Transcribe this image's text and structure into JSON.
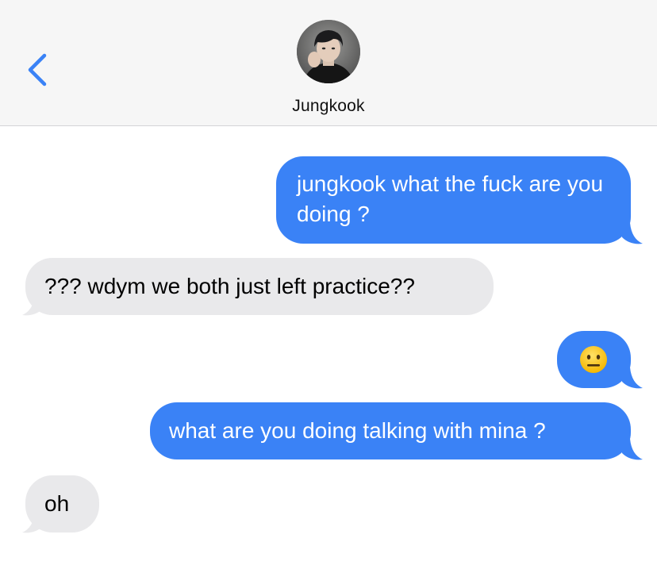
{
  "header": {
    "contact_name": "Jungkook",
    "avatar_icon": "contact-avatar-photo",
    "back_icon": "chevron-left-icon",
    "accent": "#3a82f6"
  },
  "messages": [
    {
      "direction": "sent",
      "text": "jungkook what the fuck are you doing ?"
    },
    {
      "direction": "received",
      "text": "??? wdym we both just left practice??"
    },
    {
      "direction": "sent",
      "emoji": "neutral-face-icon"
    },
    {
      "direction": "sent",
      "text": "what are you doing talking with mina ?"
    },
    {
      "direction": "received",
      "text": "oh"
    }
  ],
  "colors": {
    "sent_bubble": "#3a82f6",
    "received_bubble": "#e9e9eb",
    "header_bg": "#f6f6f6"
  }
}
